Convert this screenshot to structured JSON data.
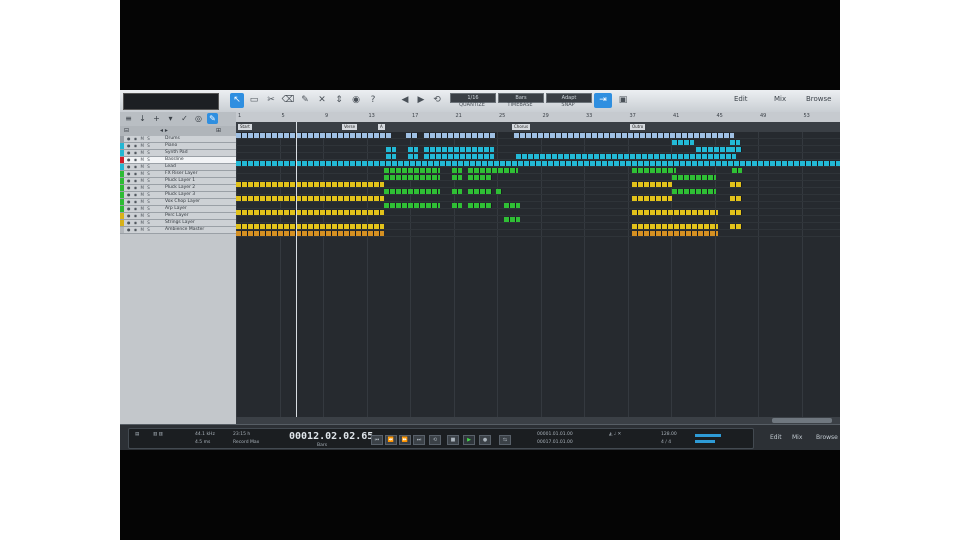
{
  "toolbar": {
    "tools": [
      {
        "name": "arrow-tool-icon",
        "glyph": "↖",
        "active": true
      },
      {
        "name": "range-tool-icon",
        "glyph": "▭",
        "active": false
      },
      {
        "name": "split-tool-icon",
        "glyph": "✂",
        "active": false
      },
      {
        "name": "eraser-tool-icon",
        "glyph": "⌫",
        "active": false
      },
      {
        "name": "paint-tool-icon",
        "glyph": "✎",
        "active": false
      },
      {
        "name": "mute-tool-icon",
        "glyph": "✕",
        "active": false
      },
      {
        "name": "bend-tool-icon",
        "glyph": "⇕",
        "active": false
      },
      {
        "name": "listen-tool-icon",
        "glyph": "◉",
        "active": false
      },
      {
        "name": "help-icon",
        "glyph": "?",
        "active": false
      }
    ],
    "quantize_label": "QUANTIZE",
    "quantize_value": "1/16",
    "timebase_label": "TIMEBASE",
    "timebase_value": "Bars",
    "snap_label": "SNAP",
    "snap_value": "Adapt",
    "right_buttons": [
      "Edit",
      "Mix",
      "Browse"
    ]
  },
  "ruler": {
    "bars": [
      "1",
      "5",
      "9",
      "13",
      "17",
      "21",
      "25",
      "29",
      "33",
      "37",
      "41",
      "45",
      "49",
      "53",
      "57"
    ]
  },
  "markers": [
    "Start",
    "Verse",
    "A",
    "Chorus",
    "Outro"
  ],
  "tracks": [
    {
      "name": "Drums",
      "color": "#9aa0a6",
      "selected": false
    },
    {
      "name": "Piano",
      "color": "#24b7d3",
      "selected": false
    },
    {
      "name": "Synth Pad",
      "color": "#24b7d3",
      "selected": false
    },
    {
      "name": "Bassline",
      "color": "#d01e2a",
      "selected": true
    },
    {
      "name": "Lead",
      "color": "#24b7d3",
      "selected": false
    },
    {
      "name": "FX Riser Layer",
      "color": "#2dbb34",
      "selected": false
    },
    {
      "name": "Pluck Layer 1",
      "color": "#2dbb34",
      "selected": false
    },
    {
      "name": "Pluck Layer 2",
      "color": "#2dbb34",
      "selected": false
    },
    {
      "name": "Pluck Layer 3",
      "color": "#2dbb34",
      "selected": false
    },
    {
      "name": "Vox Chop Layer",
      "color": "#2dbb34",
      "selected": false
    },
    {
      "name": "Arp Layer",
      "color": "#2dbb34",
      "selected": false
    },
    {
      "name": "Perc Layer",
      "color": "#d8b11a",
      "selected": false
    },
    {
      "name": "Strings Layer",
      "color": "#d8b11a",
      "selected": false
    },
    {
      "name": "Ambience Master",
      "color": "#b3b7bb",
      "selected": false
    }
  ],
  "transport": {
    "sample_rate": "44.1 kHz",
    "latency": "4.5 ms",
    "record_max": "23:15 h",
    "record_label": "Record Max",
    "time": "00012.02.02.65",
    "time_unit": "Bars",
    "loop_start": "00001.01.01.00",
    "loop_end": "00017.01.01.00",
    "tempo": "128.00",
    "signature": "4 / 4",
    "right_buttons": [
      "Edit",
      "Mix",
      "Browse"
    ]
  },
  "colors": {
    "blue_clip": "#9fc0e4",
    "cyan_clip": "#23b9d6",
    "green_clip": "#2fbf35",
    "yellow_clip": "#e2c21b",
    "orange_clip": "#d59022"
  }
}
